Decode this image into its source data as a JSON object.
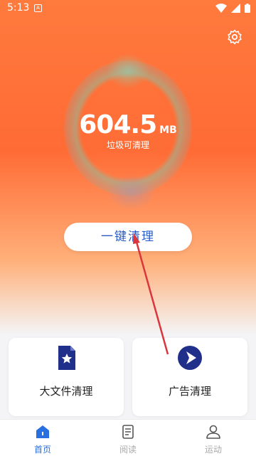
{
  "status_bar": {
    "time": "5:13",
    "notification_glyph": "A"
  },
  "scan": {
    "size_value": "604.5",
    "size_unit": "MB",
    "caption": "垃圾可清理"
  },
  "actions": {
    "one_click_clean": "一键清理"
  },
  "cards": [
    {
      "label": "大文件清理",
      "icon": "star-document-icon"
    },
    {
      "label": "广告清理",
      "icon": "play-circle-icon"
    }
  ],
  "nav": [
    {
      "label": "首页",
      "icon": "home-icon",
      "active": true
    },
    {
      "label": "阅读",
      "icon": "document-icon",
      "active": false
    },
    {
      "label": "运动",
      "icon": "person-icon",
      "active": false
    }
  ],
  "colors": {
    "hero_top": "#ff7a3d",
    "accent": "#2a6fe0",
    "card_icon": "#1f2f8a",
    "arrow": "#d9363e"
  }
}
